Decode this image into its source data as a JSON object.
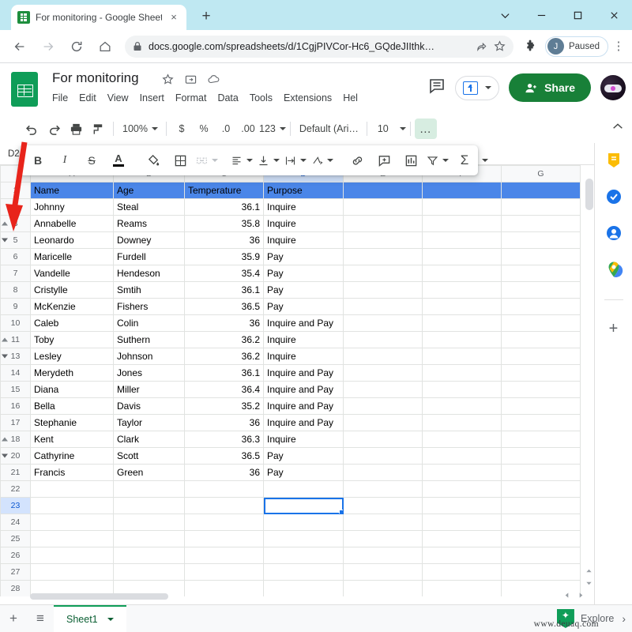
{
  "browser": {
    "tab": {
      "title": "For monitoring - Google Sheets",
      "favicon": "sheets-favicon",
      "close": "×"
    },
    "new_tab_label": "+",
    "window_controls": {
      "tab_search": "tab-search-chevron",
      "minimize": "–",
      "maximize": "□",
      "close": "✕"
    },
    "nav": {
      "back": "←",
      "forward": "→",
      "reload": "⟳",
      "home": "⌂"
    },
    "omnibox": {
      "lock_icon": "lock-icon",
      "url": "docs.google.com/spreadsheets/d/1CgjPIVCor-Hc6_GQdeJIIthk…",
      "url_domain": "docs.google.com",
      "url_path": "/spreadsheets/d/1CgjPIVCor-Hc6_GQdeJIIthk…",
      "share_icon": "share-icon",
      "bookmark_icon": "star-icon"
    },
    "extensions_icon": "puzzle-icon",
    "profile": {
      "initial": "J",
      "label": "Paused"
    },
    "menu_icon": "kebab-menu-icon"
  },
  "sheets": {
    "doc_title": "For monitoring",
    "title_icons": [
      "star-icon",
      "move-to-folder-icon",
      "cloud-saved-icon"
    ],
    "menus": [
      "File",
      "Edit",
      "View",
      "Insert",
      "Format",
      "Data",
      "Tools",
      "Extensions",
      "Hel"
    ],
    "header_actions": {
      "comment_icon": "comment-history-icon",
      "present_label": "present-button",
      "share_label": "Share",
      "avatar": "user-avatar"
    },
    "toolbar1": {
      "undo": "undo-icon",
      "redo": "redo-icon",
      "print": "print-icon",
      "paint": "paint-format-icon",
      "zoom": "100%",
      "currency": "$",
      "percent": "%",
      "dec_decrease": ".0",
      "dec_increase": ".00",
      "formats": "123",
      "font": "Default (Ari…",
      "font_size": "10",
      "more": "…",
      "collapse": "collapse-toolbar-icon"
    },
    "toolbar2": {
      "bold": "B",
      "italic": "I",
      "strikethrough": "S",
      "text_color": "A",
      "fill_color": "fill-color-icon",
      "borders": "borders-icon",
      "merge": "merge-cells-icon",
      "halign": "horizontal-align-icon",
      "valign": "vertical-align-icon",
      "wrap": "text-wrap-icon",
      "rotate": "text-rotation-icon",
      "link": "insert-link-icon",
      "comment": "insert-comment-icon",
      "chart": "insert-chart-icon",
      "filter": "filter-icon",
      "functions": "Σ"
    },
    "name_box": "D2",
    "columns": [
      "A",
      "B",
      "C",
      "D",
      "E",
      "F",
      "G"
    ],
    "selected_column": "D",
    "selected_cell": "D23",
    "grid": {
      "header_fill": "#4a86e8",
      "rows": [
        {
          "n": "1",
          "header": true,
          "cells": [
            "Name",
            "Age",
            "Temperature",
            "Purpose"
          ]
        },
        {
          "n": "2",
          "cells": [
            "Johnny",
            "Steal",
            "36.1",
            "Inquire"
          ]
        },
        {
          "n": "3",
          "group": "up",
          "cells": [
            "Annabelle",
            "Reams",
            "35.8",
            "Inquire"
          ]
        },
        {
          "n": "5",
          "group": "down",
          "cells": [
            "Leonardo",
            "Downey",
            "36",
            "Inquire"
          ]
        },
        {
          "n": "6",
          "cells": [
            "Maricelle",
            "Furdell",
            "35.9",
            "Pay"
          ]
        },
        {
          "n": "7",
          "cells": [
            "Vandelle",
            "Hendeson",
            "35.4",
            "Pay"
          ]
        },
        {
          "n": "8",
          "cells": [
            "Cristylle",
            "Smtih",
            "36.1",
            "Pay"
          ]
        },
        {
          "n": "9",
          "cells": [
            "McKenzie",
            "Fishers",
            "36.5",
            "Pay"
          ]
        },
        {
          "n": "10",
          "cells": [
            "Caleb",
            "Colin",
            "36",
            "Inquire and Pay"
          ]
        },
        {
          "n": "11",
          "group": "up",
          "cells": [
            "Toby",
            "Suthern",
            "36.2",
            "Inquire"
          ]
        },
        {
          "n": "13",
          "group": "down",
          "cells": [
            "Lesley",
            "Johnson",
            "36.2",
            "Inquire"
          ]
        },
        {
          "n": "14",
          "cells": [
            "Merydeth",
            "Jones",
            "36.1",
            "Inquire and Pay"
          ]
        },
        {
          "n": "15",
          "cells": [
            "Diana",
            "Miller",
            "36.4",
            "Inquire and Pay"
          ]
        },
        {
          "n": "16",
          "cells": [
            "Bella",
            "Davis",
            "35.2",
            "Inquire and Pay"
          ]
        },
        {
          "n": "17",
          "cells": [
            "Stephanie",
            "Taylor",
            "36",
            "Inquire and Pay"
          ]
        },
        {
          "n": "18",
          "group": "up",
          "cells": [
            "Kent",
            "Clark",
            "36.3",
            "Inquire"
          ]
        },
        {
          "n": "20",
          "group": "down",
          "cells": [
            "Cathyrine",
            "Scott",
            "36.5",
            "Pay"
          ]
        },
        {
          "n": "21",
          "cells": [
            "Francis",
            "Green",
            "36",
            "Pay"
          ]
        },
        {
          "n": "22",
          "cells": [
            "",
            "",
            "",
            ""
          ]
        },
        {
          "n": "23",
          "selected": true,
          "cells": [
            "",
            "",
            "",
            ""
          ]
        },
        {
          "n": "24",
          "cells": [
            "",
            "",
            "",
            ""
          ]
        },
        {
          "n": "25",
          "cells": [
            "",
            "",
            "",
            ""
          ]
        },
        {
          "n": "26",
          "cells": [
            "",
            "",
            "",
            ""
          ]
        },
        {
          "n": "27",
          "cells": [
            "",
            "",
            "",
            ""
          ]
        },
        {
          "n": "28",
          "cells": [
            "",
            "",
            "",
            ""
          ]
        }
      ]
    },
    "side_panel": [
      "keep-icon",
      "tasks-icon",
      "contacts-icon",
      "maps-icon",
      "add-on-plus-icon"
    ],
    "bottom": {
      "add_sheet": "+",
      "all_sheets": "≡",
      "sheet_name": "Sheet1",
      "explore_label": "Explore",
      "expand": "›"
    }
  },
  "annotations": {
    "watermark": "www.deuaq.com",
    "arrow_color": "#e8241b"
  }
}
